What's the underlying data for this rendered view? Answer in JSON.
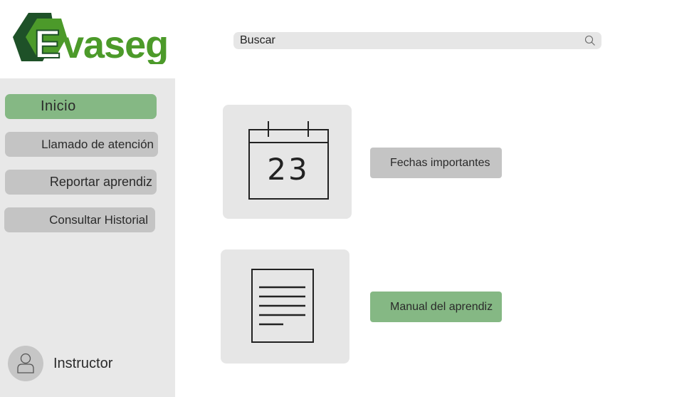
{
  "brand": {
    "name": "Evaseg",
    "initial": "E",
    "rest": "vaseg"
  },
  "colors": {
    "brand_dark": "#1e5128",
    "brand_green": "#4c9a2a",
    "active_nav": "#85b884",
    "inactive_nav": "#c4c4c4"
  },
  "search": {
    "placeholder": "Buscar",
    "icon": "search-icon"
  },
  "sidebar": {
    "items": [
      {
        "label": "Inicio",
        "active": true
      },
      {
        "label": "Llamado de atención",
        "active": false
      },
      {
        "label": "Reportar aprendiz",
        "active": false
      },
      {
        "label": "Consultar Historial",
        "active": false
      }
    ],
    "user": {
      "name": "Instructor",
      "icon": "user-icon"
    }
  },
  "main": {
    "calendar": {
      "day": "23",
      "icon": "calendar-icon",
      "button_label": "Fechas importantes"
    },
    "manual": {
      "icon": "document-icon",
      "button_label": "Manual del aprendiz"
    }
  }
}
